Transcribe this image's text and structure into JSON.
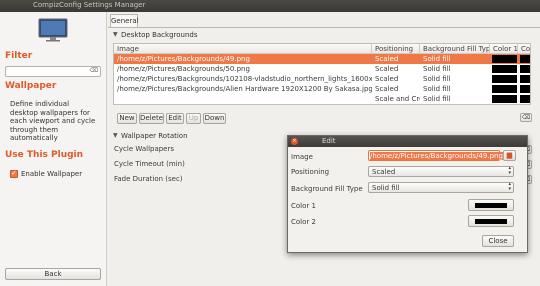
{
  "window": {
    "title": "CompizConfig Settings Manager"
  },
  "sidebar": {
    "filter_heading": "Filter",
    "filter_value": "",
    "plugin_heading": "Wallpaper",
    "description": "Define individual desktop wallpapers for each viewport and cycle through them automatically",
    "use_heading": "Use This Plugin",
    "enable_label": "Enable Wallpaper",
    "enabled": true,
    "back_label": "Back"
  },
  "tab": {
    "label": "General"
  },
  "desktop_backgrounds": {
    "section_label": "Desktop Backgrounds",
    "columns": [
      "Image",
      "Positioning",
      "Background Fill Type",
      "Color 1",
      "Colo"
    ],
    "rows": [
      {
        "image": "/home/z/Pictures/Backgrounds/49.png",
        "positioning": "Scaled",
        "fill": "Solid fill",
        "has_color": true,
        "selected": true
      },
      {
        "image": "/home/z/Pictures/Backgrounds/50.png",
        "positioning": "Scaled",
        "fill": "Solid fill",
        "has_color": true,
        "selected": false
      },
      {
        "image": "/home/z/Pictures/Backgrounds/102108-vladstudio_northern_lights_1600x1200.jpg",
        "positioning": "Scaled",
        "fill": "Solid fill",
        "has_color": true,
        "selected": false
      },
      {
        "image": "/home/z/Pictures/Backgrounds/Alien Hardware 1920X1200 By Sakasa.jpg",
        "positioning": "Scaled",
        "fill": "Solid fill",
        "has_color": true,
        "selected": false
      },
      {
        "image": "",
        "positioning": "Scale and Crop",
        "fill": "Solid fill",
        "has_color": true,
        "selected": false
      }
    ],
    "buttons": {
      "new": "New",
      "delete": "Delete",
      "edit": "Edit",
      "up": "Up",
      "down": "Down"
    }
  },
  "wallpaper_rotation": {
    "section_label": "Wallpaper Rotation",
    "cycle_wallpapers": "Cycle Wallpapers",
    "cycle_timeout": "Cycle Timeout (min)",
    "fade_duration": "Fade Duration (sec)"
  },
  "edit_dialog": {
    "title": "Edit",
    "image_label": "Image",
    "image_value": "/home/z/Pictures/Backgrounds/49.png",
    "positioning_label": "Positioning",
    "positioning_value": "Scaled",
    "fill_label": "Background Fill Type",
    "fill_value": "Solid fill",
    "color1_label": "Color 1",
    "color2_label": "Color 2",
    "close_label": "Close"
  },
  "colors": {
    "accent": "#f07746",
    "swatch": "#000000"
  }
}
